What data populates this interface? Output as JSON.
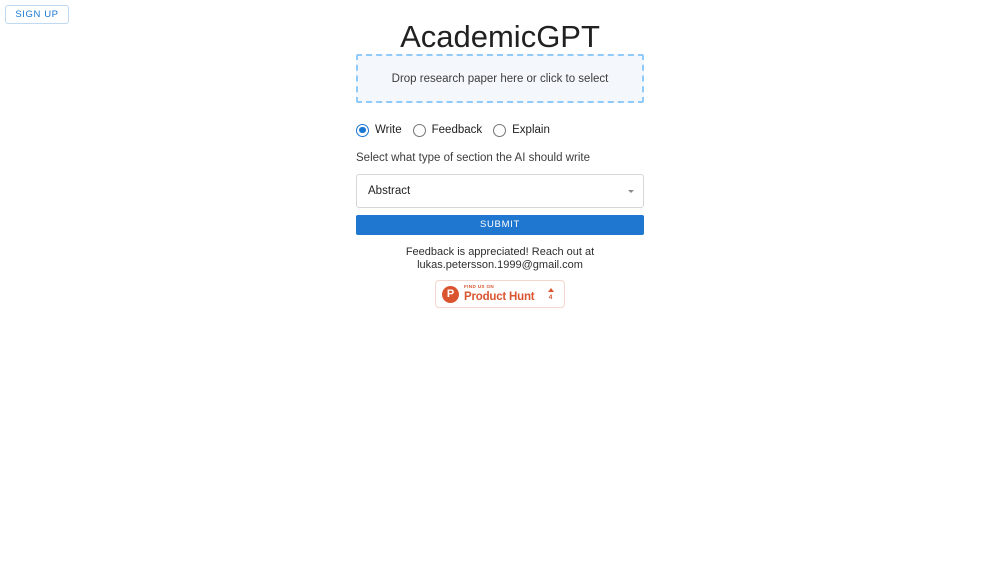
{
  "header": {
    "signup_label": "SIGN UP",
    "app_title": "AcademicGPT"
  },
  "dropzone": {
    "text": "Drop research paper here or click to select"
  },
  "mode_radios": {
    "selected": "Write",
    "options": [
      {
        "label": "Write",
        "selected": true
      },
      {
        "label": "Feedback",
        "selected": false
      },
      {
        "label": "Explain",
        "selected": false
      }
    ]
  },
  "section_select": {
    "label": "Select what type of section the AI should write",
    "value": "Abstract"
  },
  "submit": {
    "label": "SUBMIT"
  },
  "feedback": {
    "line1": "Feedback is appreciated! Reach out at",
    "line2": "lukas.petersson.1999@gmail.com"
  },
  "product_hunt": {
    "kicker": "FIND US ON",
    "name": "Product Hunt",
    "upvotes": "4"
  },
  "colors": {
    "primary": "#1976d2",
    "submit_blue": "#1f77cf",
    "dropzone_border": "#90caf9",
    "dropzone_fill": "#f4f8fc",
    "product_hunt": "#da552f",
    "background": "#ffffff"
  }
}
